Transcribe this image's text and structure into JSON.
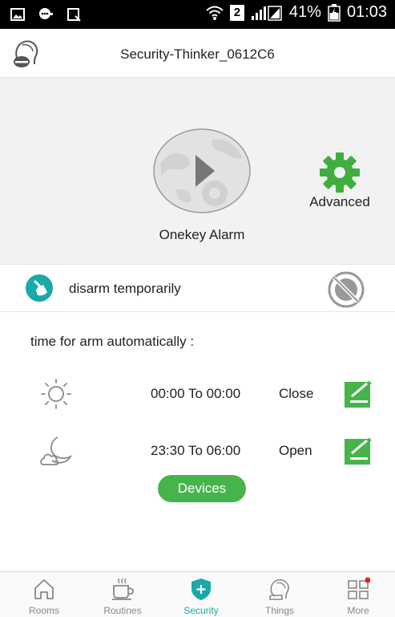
{
  "status_bar": {
    "battery": "41%",
    "sim_slot": "2",
    "time": "01:03"
  },
  "header": {
    "title": "Security-Thinker_0612C6"
  },
  "alarm_panel": {
    "onekey_label": "Onekey Alarm",
    "advanced_label": "Advanced"
  },
  "disarm": {
    "label": "disarm temporarily"
  },
  "schedule": {
    "title": "time for arm automatically :",
    "rows": [
      {
        "icon": "sun-icon",
        "time": "00:00 To 00:00",
        "state": "Close"
      },
      {
        "icon": "moon-cloud-icon",
        "time": "23:30 To 06:00",
        "state": "Open"
      }
    ],
    "devices_label": "Devices"
  },
  "bottom_nav": {
    "items": [
      {
        "icon": "home-icon",
        "label": "Rooms"
      },
      {
        "icon": "coffee-cup-icon",
        "label": "Routines"
      },
      {
        "icon": "shield-plus-icon",
        "label": "Security",
        "active": true
      },
      {
        "icon": "head-icon",
        "label": "Things"
      },
      {
        "icon": "grid-icon",
        "label": "More",
        "badge": true
      }
    ]
  },
  "colors": {
    "accent_green": "#47b44b",
    "accent_teal": "#1aa8a8",
    "panel_gray": "#f2f2f2"
  }
}
